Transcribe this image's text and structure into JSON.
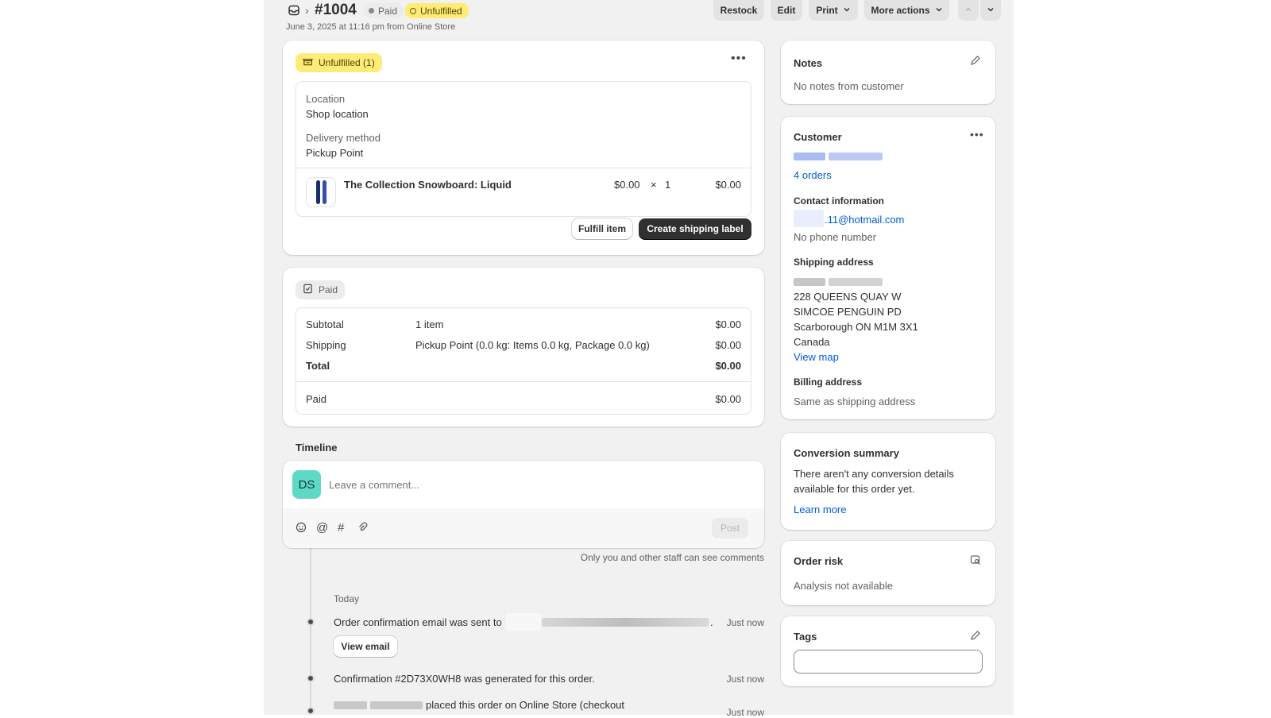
{
  "header": {
    "order_number": "#1004",
    "badge_paid": "Paid",
    "badge_unfulfilled": "Unfulfilled",
    "subtitle": "June 3, 2025 at 11:16 pm from Online Store",
    "actions": {
      "restock": "Restock",
      "edit": "Edit",
      "print": "Print",
      "more": "More actions"
    }
  },
  "fulfillment": {
    "status_label": "Unfulfilled (1)",
    "location_label": "Location",
    "location_value": "Shop location",
    "delivery_label": "Delivery method",
    "delivery_value": "Pickup Point",
    "item": {
      "name": "The Collection Snowboard: Liquid",
      "price": "$0.00",
      "times": "×",
      "qty": "1",
      "total": "$0.00"
    },
    "fulfill_button": "Fulfill item",
    "shipping_label_button": "Create shipping label"
  },
  "payment": {
    "status_label": "Paid",
    "rows": [
      {
        "label": "Subtotal",
        "desc": "1 item",
        "amount": "$0.00"
      },
      {
        "label": "Shipping",
        "desc": "Pickup Point (0.0 kg: Items 0.0 kg, Package 0.0 kg)",
        "amount": "$0.00"
      },
      {
        "label": "Total",
        "desc": "",
        "amount": "$0.00"
      }
    ],
    "paid_label": "Paid",
    "paid_amount": "$0.00"
  },
  "timeline": {
    "title": "Timeline",
    "avatar_initials": "DS",
    "comment_placeholder": "Leave a comment...",
    "post_button": "Post",
    "staff_note": "Only you and other staff can see comments",
    "day_label": "Today",
    "events": [
      {
        "text": "Order confirmation email was sent to",
        "time": "Just now",
        "action": "View email"
      },
      {
        "text": "Confirmation #2D73X0WH8 was generated for this order.",
        "time": "Just now"
      },
      {
        "text": "placed this order on Online Store (checkout",
        "time": "Just now"
      }
    ]
  },
  "notes": {
    "title": "Notes",
    "body": "No notes from customer"
  },
  "customer": {
    "title": "Customer",
    "orders_link": "4 orders",
    "contact_title": "Contact information",
    "email": ".11@hotmail.com",
    "phone": "No phone number",
    "shipping_title": "Shipping address",
    "address_lines": [
      "228 QUEENS QUAY W",
      "SIMCOE PENGUIN PD",
      "Scarborough ON M1M 3X1",
      "Canada"
    ],
    "view_map": "View map",
    "billing_title": "Billing address",
    "billing_body": "Same as shipping address"
  },
  "conversion": {
    "title": "Conversion summary",
    "body_line1": "There aren't any conversion details",
    "body_line2": "available for this order yet.",
    "learn_more": "Learn more"
  },
  "risk": {
    "title": "Order risk",
    "body": "Analysis not available"
  },
  "tags": {
    "title": "Tags",
    "input_value": ""
  },
  "colors": {
    "accent": "#005bd3",
    "unfulfilled_bg": "#ffeb78",
    "avatar_bg": "#5ed9c5",
    "dark_button": "#303030"
  }
}
